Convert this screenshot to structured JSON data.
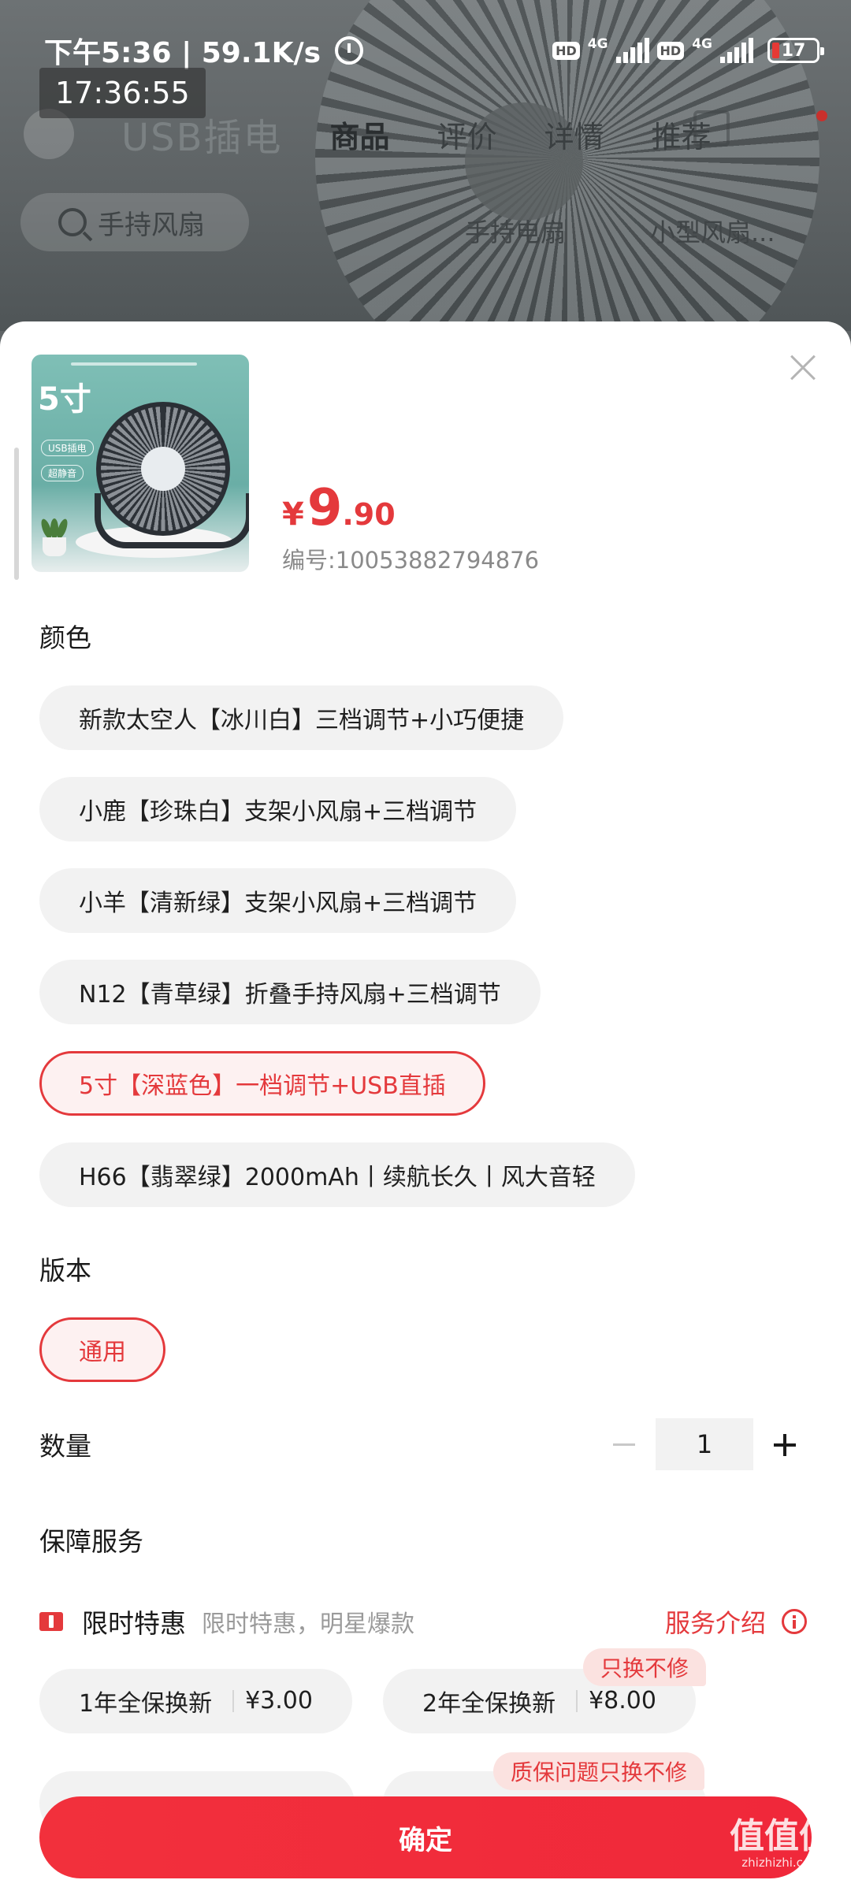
{
  "status_bar": {
    "time_speed": "下午5:36 | 59.1K/s",
    "hd1": "HD",
    "net1": "4G",
    "hd2": "HD",
    "net2": "4G",
    "battery": "17",
    "clock_overlay": "17:36:55"
  },
  "background_page": {
    "image_text": "USB插电",
    "tabs": [
      "商品",
      "评价",
      "详情",
      "推荐"
    ],
    "image_tag": "超静音",
    "search_text": "手持风扇",
    "hot_words": [
      "手持电扇",
      "小型风扇..."
    ]
  },
  "product": {
    "thumbnail": {
      "size_label": "5寸",
      "tags": [
        "USB插电",
        "超静音"
      ]
    },
    "price_symbol": "¥",
    "price_integer": "9",
    "price_decimal": ".90",
    "sku_code": "编号:10053882794876"
  },
  "color_section": {
    "title": "颜色",
    "options": [
      "新款太空人【冰川白】三档调节+小巧便捷",
      "小鹿【珍珠白】支架小风扇+三档调节",
      "小羊【清新绿】支架小风扇+三档调节",
      "N12【青草绿】折叠手持风扇+三档调节",
      "5寸【深蓝色】一档调节+USB直插",
      "H66【翡翠绿】2000mAh丨续航长久丨风大音轻"
    ],
    "selected": "5寸【深蓝色】一档调节+USB直插"
  },
  "version_section": {
    "title": "版本",
    "options": [
      "通用"
    ],
    "selected": "通用"
  },
  "quantity": {
    "label": "数量",
    "value": "1"
  },
  "service_section": {
    "title": "保障服务",
    "promo_title": "限时特惠",
    "promo_desc": "限时特惠，明星爆款",
    "promo_link": "服务介绍",
    "plans": [
      {
        "name": "1年全保换新",
        "price": "¥3.00",
        "tag": ""
      },
      {
        "name": "2年全保换新",
        "price": "¥8.00",
        "tag": "只换不修"
      }
    ],
    "next_row_tag": "质保问题只换不修"
  },
  "confirm_button": "确定",
  "watermark": {
    "main": "值值值",
    "sub": "zhizhizhi.com"
  },
  "colors": {
    "accent": "#e4393c",
    "chip_bg": "#f2f2f2",
    "selected_chip_bg": "#fdf1f1",
    "tag_bg": "#fbe2e0"
  }
}
